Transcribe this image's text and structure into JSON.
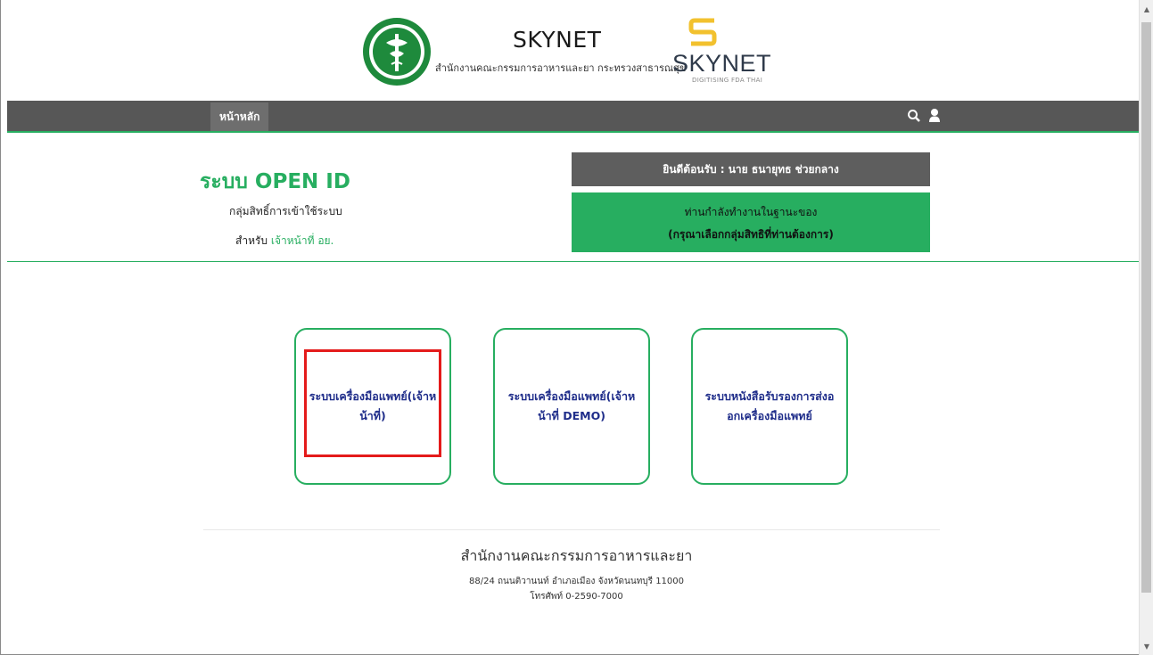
{
  "header": {
    "title": "SKYNET",
    "subtitle": "สำนักงานคณะกรรมการอาหารและยา กระทรวงสาธารณสุข",
    "brand_word": "SKYNET",
    "brand_tagline": "DIGITISING FDA THAI"
  },
  "nav": {
    "home": "หน้าหลัก",
    "search_icon": "search-icon",
    "user_icon": "user-icon"
  },
  "info": {
    "title": "ระบบ OPEN ID",
    "line1": "กลุ่มสิทธิ์การเข้าใช้ระบบ",
    "line2_prefix": "สำหรับ",
    "line2_accent": "เจ้าหน้าที่ อย."
  },
  "welcome": "ยินดีต้อนรับ : นาย ธนายุทธ ช่วยกลาง",
  "role": {
    "line1": "ท่านกำลังทำงานในฐานะของ",
    "line2": "(กรุณาเลือกกลุ่มสิทธิที่ท่านต้องการ)"
  },
  "cards": [
    "ระบบเครื่องมือแพทย์(เจ้าหน้าที่)",
    "ระบบเครื่องมือแพทย์(เจ้าหน้าที่ DEMO)",
    "ระบบหนังสือรับรองการส่งออกเครื่องมือแพทย์"
  ],
  "footer": {
    "org": "สำนักงานคณะกรรมการอาหารและยา",
    "address": "88/24 ถนนติวานนท์ อำเภอเมือง จังหวัดนนทบุรี 11000",
    "phone": "โทรศัพท์ 0-2590-7000"
  },
  "colors": {
    "accent": "#27ae60",
    "nav_bg": "#575757",
    "card_text": "#1f2d8a",
    "highlight": "#e41b1b",
    "brand_yellow": "#f2c12e"
  }
}
